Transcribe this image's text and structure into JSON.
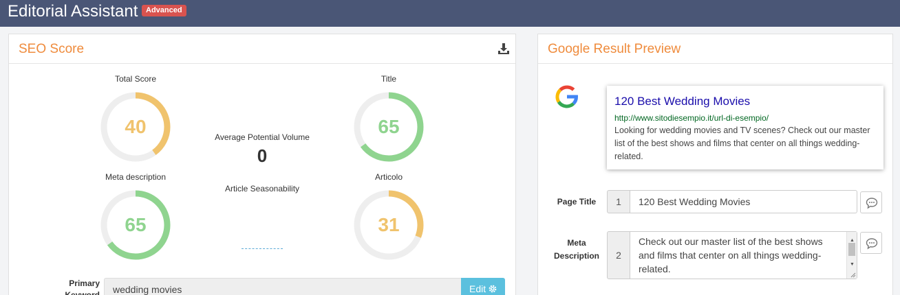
{
  "app": {
    "title": "Editorial Assistant",
    "badge": "Advanced"
  },
  "seo": {
    "title": "SEO Score",
    "gauges": [
      {
        "label": "Total Score",
        "value": 40,
        "color": "#f0c36d"
      },
      {
        "label": "Title",
        "value": 65,
        "color": "#8fd48f"
      },
      {
        "label": "Meta description",
        "value": 65,
        "color": "#8fd48f"
      },
      {
        "label": "Articolo",
        "value": 31,
        "color": "#f0c36d"
      }
    ],
    "avg_volume_label": "Average Potential Volume",
    "avg_volume_value": "0",
    "seasonality_label": "Article Seasonability",
    "keyword_label": "Primary Keyword",
    "keyword_value": "wedding movies",
    "edit_label": "Edit"
  },
  "preview": {
    "title": "Google Result Preview",
    "serp_title": "120 Best Wedding Movies",
    "serp_url": "http://www.sitodiesempio.it/url-di-esempio/",
    "serp_desc": "Looking for wedding movies and TV scenes? Check out our master list of the best shows and films that center on all things wedding-related.",
    "page_title_label": "Page Title",
    "page_title_num": "1",
    "page_title_value": "120 Best Wedding Movies",
    "meta_label": "Meta Description",
    "meta_num": "2",
    "meta_value": "Check out our master list of the best shows and films that center on all things wedding-related."
  },
  "colors": {
    "topbar": "#4a5676",
    "accent": "#ef8b3c",
    "badge": "#d9534f",
    "edit": "#5bc0de",
    "track": "#eeeeee"
  },
  "icons": {
    "download": "download-icon",
    "google": "google-logo-icon",
    "comment": "comment-icon",
    "gear": "gear-icon"
  }
}
